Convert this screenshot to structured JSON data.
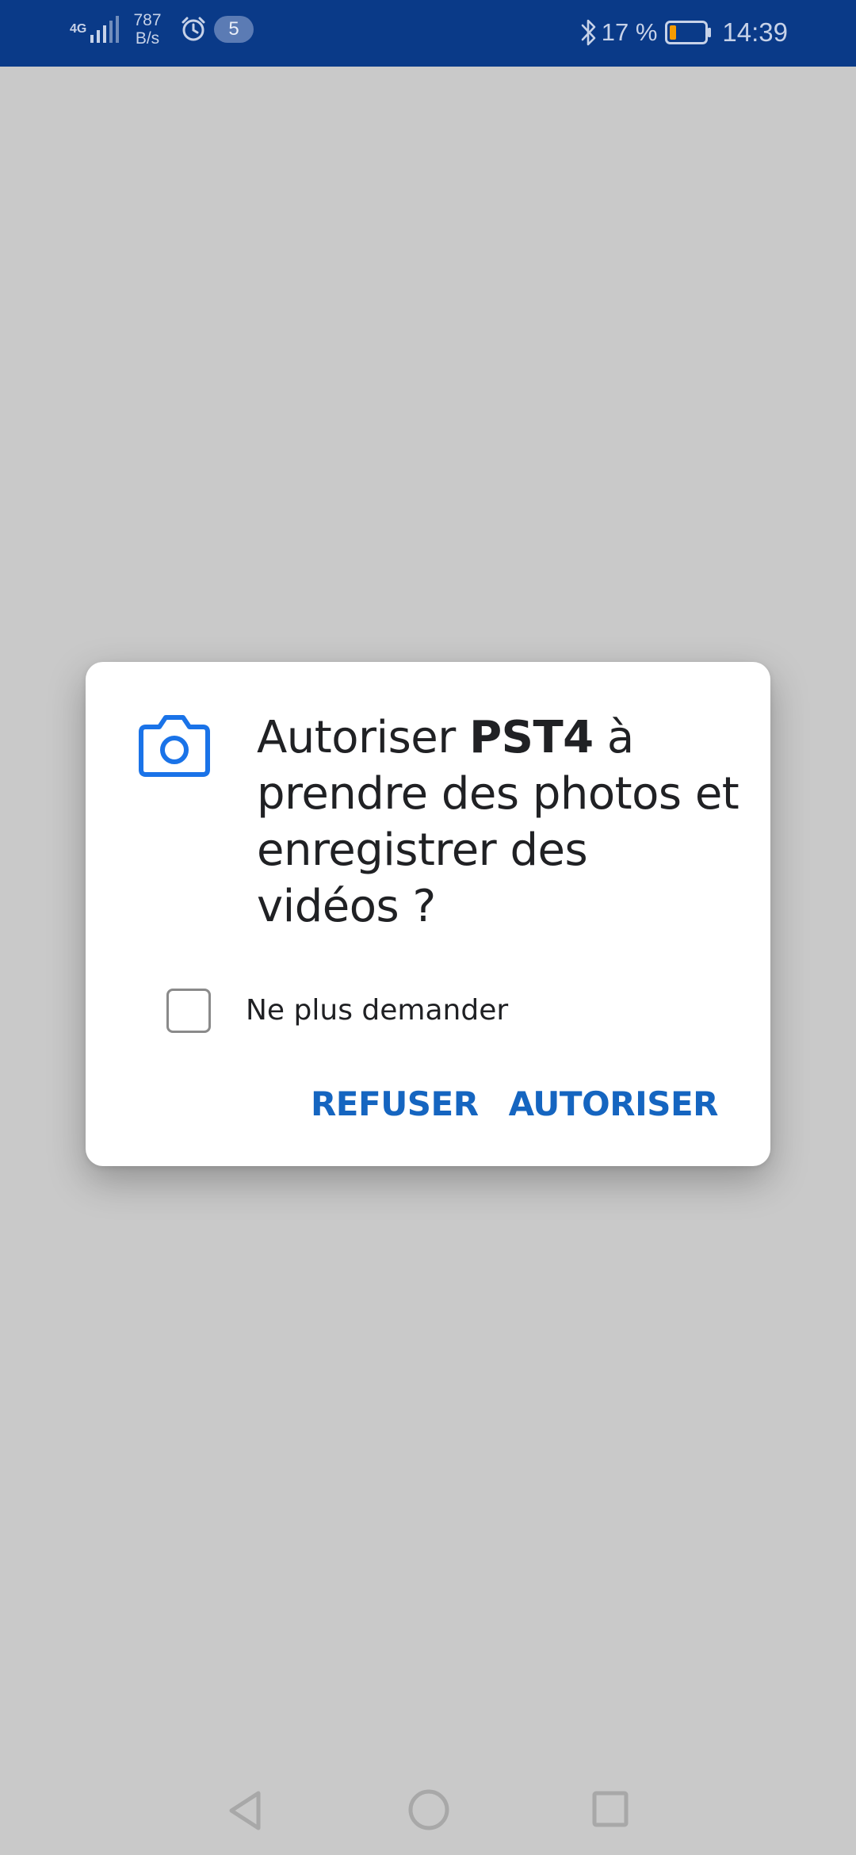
{
  "status_bar": {
    "network_type": "4G",
    "data_speed_value": "787",
    "data_speed_unit": "B/s",
    "notification_count": "5",
    "battery_percent": "17 %",
    "time": "14:39",
    "icons": [
      "signal-icon",
      "alarm-icon",
      "bluetooth-icon",
      "battery-icon"
    ]
  },
  "dialog": {
    "icon": "camera-icon",
    "title_prefix": "Autoriser ",
    "app_name": "PST4",
    "title_suffix": " à prendre des photos et enregistrer des vidéos ?",
    "checkbox_label": "Ne plus demander",
    "checkbox_checked": false,
    "deny_button": "REFUSER",
    "allow_button": "AUTORISER"
  },
  "navigation_bar": {
    "icons": [
      "back-icon",
      "home-icon",
      "recents-icon"
    ]
  },
  "colors": {
    "status_bar_bg": "#0a3a88",
    "scrim": "#c9c9c9",
    "accent": "#1565c0",
    "camera_icon": "#1a73e8",
    "battery_low": "#f59b00"
  }
}
